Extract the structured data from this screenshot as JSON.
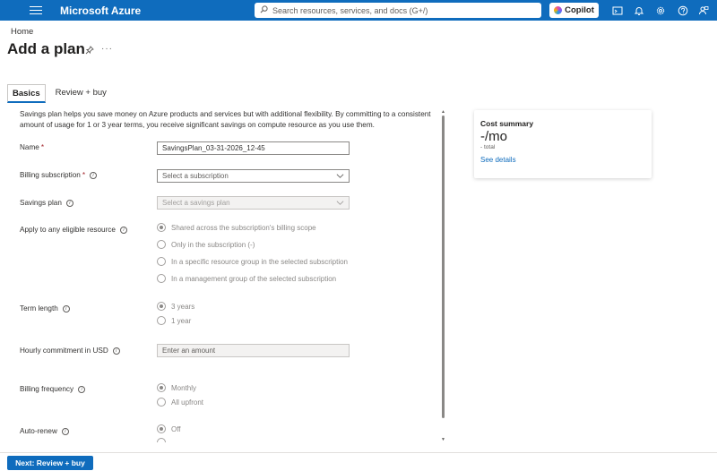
{
  "header": {
    "brand": "Microsoft Azure",
    "search_placeholder": "Search resources, services, and docs (G+/)",
    "copilot_label": "Copilot"
  },
  "breadcrumb": "Home",
  "page_title": "Add a plan",
  "more_label": "···",
  "tabs": [
    {
      "label": "Basics",
      "active": true
    },
    {
      "label": "Review + buy",
      "active": false
    }
  ],
  "intro": "Savings plan helps you save money on Azure products and services but with additional flexibility. By committing to a consistent amount of usage for 1 or 3 year terms, you receive significant savings on compute resource as you use them.",
  "form": {
    "name_label": "Name",
    "name_value": "SavingsPlan_03-31-2026_12-45",
    "billing_sub_label": "Billing subscription",
    "billing_sub_placeholder": "Select a subscription",
    "savings_plan_label": "Savings plan",
    "savings_plan_placeholder": "Select a savings plan",
    "apply_label": "Apply to any eligible resource",
    "apply_options": [
      "Shared across the subscription's billing scope",
      "Only in the subscription (-)",
      "In a specific resource group in the selected subscription",
      "In a management group of the selected subscription"
    ],
    "term_label": "Term length",
    "term_options": [
      "3 years",
      "1 year"
    ],
    "hourly_label": "Hourly commitment in USD",
    "hourly_placeholder": "Enter an amount",
    "billing_freq_label": "Billing frequency",
    "billing_freq_options": [
      "Monthly",
      "All upfront"
    ],
    "autorenew_label": "Auto-renew",
    "autorenew_options": [
      "Off"
    ]
  },
  "cost_summary": {
    "title": "Cost summary",
    "value": "-/mo",
    "sub": "- total",
    "link": "See details"
  },
  "footer": {
    "next_label": "Next: Review + buy"
  },
  "colors": {
    "accent": "#0f6cbd",
    "required": "#a4262c"
  }
}
